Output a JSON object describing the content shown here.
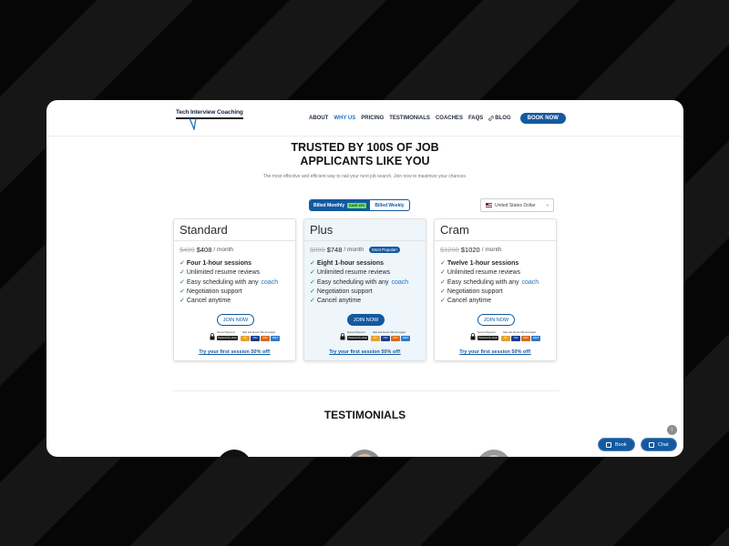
{
  "brand": {
    "logo_text": "Tech Interview Coaching"
  },
  "nav": {
    "items": [
      {
        "label": "ABOUT",
        "active": false
      },
      {
        "label": "WHY US",
        "active": true
      },
      {
        "label": "PRICING",
        "active": false
      },
      {
        "label": "TESTIMONIALS",
        "active": false
      },
      {
        "label": "COACHES",
        "active": false
      },
      {
        "label": "FAQS",
        "active": false
      }
    ],
    "blog_label": "BLOG",
    "book_label": "BOOK NOW"
  },
  "hero": {
    "title_line1": "TRUSTED BY 100S OF JOB",
    "title_line2": "APPLICANTS LIKE YOU",
    "subtitle": "The most effective and efficient way to nail your next job search. Join now to maximize your chances."
  },
  "billing": {
    "monthly_label": "Billed Monthly",
    "save_badge": "SAVE 15%",
    "weekly_label": "Billed Weekly",
    "selected": "monthly"
  },
  "currency": {
    "selected": "United States Dollar"
  },
  "plans": [
    {
      "name": "Standard",
      "old_price": "$480",
      "price": "$408",
      "per": "/ month",
      "badge": "",
      "features": [
        {
          "text": "Four 1-hour sessions",
          "bold": true
        },
        {
          "text": "Unlimited resume reviews",
          "bold": false
        },
        {
          "text": "Easy scheduling with any",
          "link": "coach"
        },
        {
          "text": "Negotiation support",
          "bold": false
        },
        {
          "text": "Cancel anytime",
          "bold": false
        }
      ],
      "cta": "JOIN NOW",
      "trial": "Try your first session 50% off!"
    },
    {
      "name": "Plus",
      "old_price": "$880",
      "price": "$748",
      "per": "/ month",
      "badge": "Most Popular!",
      "features": [
        {
          "text": "Eight 1-hour sessions",
          "bold": true
        },
        {
          "text": "Unlimited resume reviews",
          "bold": false
        },
        {
          "text": "Easy scheduling with any",
          "link": "coach"
        },
        {
          "text": "Negotiation support",
          "bold": false
        },
        {
          "text": "Cancel anytime",
          "bold": false
        }
      ],
      "cta": "JOIN NOW",
      "trial": "Try your first session 50% off!"
    },
    {
      "name": "Cram",
      "old_price": "$1200",
      "price": "$1020",
      "per": "/ month",
      "badge": "",
      "features": [
        {
          "text": "Twelve 1-hour sessions",
          "bold": true
        },
        {
          "text": "Unlimited resume reviews",
          "bold": false
        },
        {
          "text": "Easy scheduling with any",
          "link": "coach"
        },
        {
          "text": "Negotiation support",
          "bold": false
        },
        {
          "text": "Cancel anytime",
          "bold": false
        }
      ],
      "cta": "JOIN NOW",
      "trial": "Try your first session 50% off!"
    }
  ],
  "secure": {
    "line1": "Secure Payments",
    "line2": "Safe and Secure SSL Encrypted",
    "stripe": "Powered by stripe",
    "cards": [
      {
        "name": "MC",
        "color": "#e8a12a"
      },
      {
        "name": "VISA",
        "color": "#1a3a8c"
      },
      {
        "name": "DISC",
        "color": "#d36b1f"
      },
      {
        "name": "AMEX",
        "color": "#2f79c7"
      }
    ]
  },
  "testimonials": {
    "title": "TESTIMONIALS"
  },
  "floating": {
    "book_label": "Book",
    "chat_label": "Chat",
    "scroll_top_icon": "arrow-up-icon"
  },
  "colors": {
    "primary": "#135aa0",
    "link": "#1f72c3",
    "check": "#1a7a1a",
    "save_badge": "#72e06a"
  }
}
